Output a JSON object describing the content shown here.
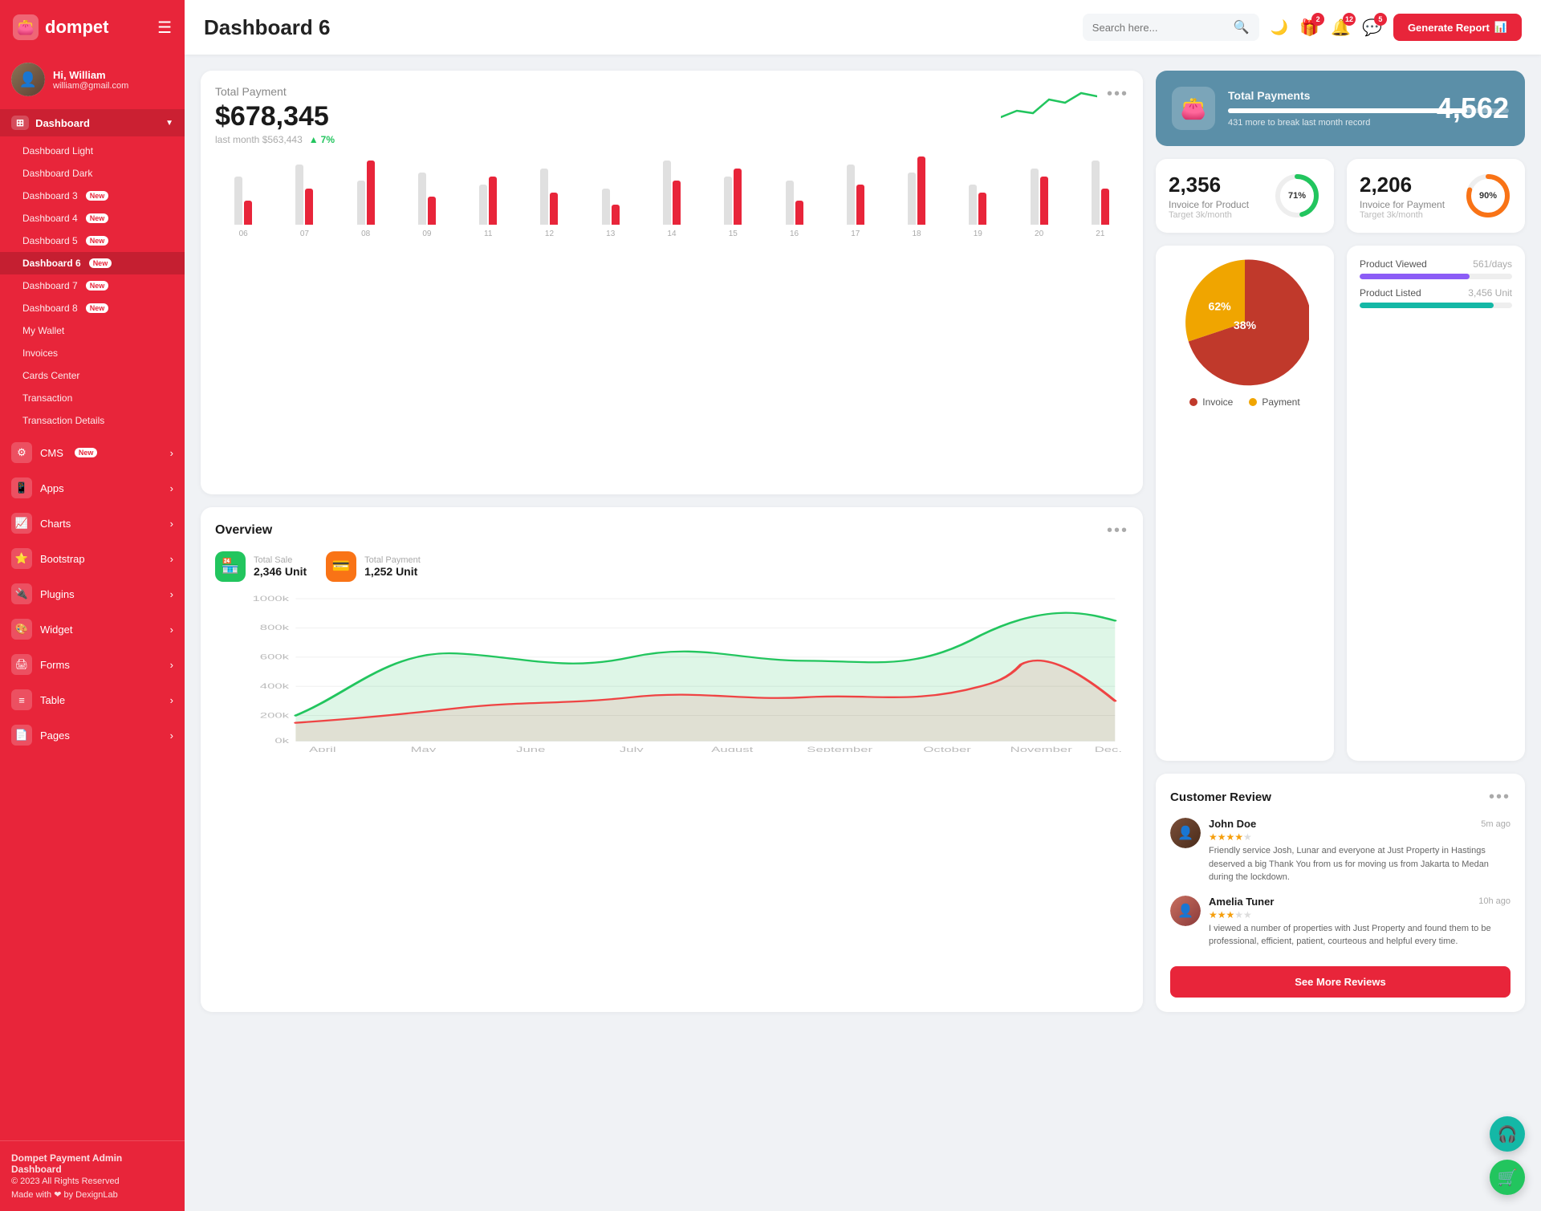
{
  "brand": {
    "name": "dompet",
    "logo_icon": "👛"
  },
  "user": {
    "greeting": "Hi, William",
    "email": "william@gmail.com",
    "avatar_char": "👤"
  },
  "sidebar": {
    "dashboard_label": "Dashboard",
    "items": [
      {
        "label": "Dashboard Light",
        "new": false,
        "active": false
      },
      {
        "label": "Dashboard Dark",
        "new": false,
        "active": false
      },
      {
        "label": "Dashboard 3",
        "new": true,
        "active": false
      },
      {
        "label": "Dashboard 4",
        "new": true,
        "active": false
      },
      {
        "label": "Dashboard 5",
        "new": true,
        "active": false
      },
      {
        "label": "Dashboard 6",
        "new": true,
        "active": true
      },
      {
        "label": "Dashboard 7",
        "new": true,
        "active": false
      },
      {
        "label": "Dashboard 8",
        "new": true,
        "active": false
      },
      {
        "label": "My Wallet",
        "new": false,
        "active": false
      },
      {
        "label": "Invoices",
        "new": false,
        "active": false
      },
      {
        "label": "Cards Center",
        "new": false,
        "active": false
      },
      {
        "label": "Transaction",
        "new": false,
        "active": false
      },
      {
        "label": "Transaction Details",
        "new": false,
        "active": false
      }
    ],
    "menu_items": [
      {
        "label": "CMS",
        "icon": "⚙",
        "new": true,
        "has_arrow": true
      },
      {
        "label": "Apps",
        "icon": "📱",
        "new": false,
        "has_arrow": true
      },
      {
        "label": "Charts",
        "icon": "📈",
        "new": false,
        "has_arrow": true
      },
      {
        "label": "Bootstrap",
        "icon": "⭐",
        "new": false,
        "has_arrow": true
      },
      {
        "label": "Plugins",
        "icon": "🔌",
        "new": false,
        "has_arrow": true
      },
      {
        "label": "Widget",
        "icon": "🎨",
        "new": false,
        "has_arrow": true
      },
      {
        "label": "Forms",
        "icon": "🖨",
        "new": false,
        "has_arrow": true
      },
      {
        "label": "Table",
        "icon": "≡",
        "new": false,
        "has_arrow": true
      },
      {
        "label": "Pages",
        "icon": "📄",
        "new": false,
        "has_arrow": true
      }
    ],
    "footer": {
      "brand": "Dompet Payment Admin Dashboard",
      "copy": "© 2023 All Rights Reserved",
      "made": "Made with ❤ by DexignLab"
    }
  },
  "topbar": {
    "title": "Dashboard 6",
    "search_placeholder": "Search here...",
    "badges": {
      "gift": 2,
      "bell": 12,
      "message": 5
    },
    "generate_btn": "Generate Report"
  },
  "total_payment": {
    "title": "Total Payment",
    "amount": "$678,345",
    "last_month_label": "last month $563,443",
    "trend_pct": "7%",
    "dots": "...",
    "bars": [
      {
        "label": "06",
        "gray": 60,
        "red": 30
      },
      {
        "label": "07",
        "gray": 75,
        "red": 45
      },
      {
        "label": "08",
        "gray": 55,
        "red": 80
      },
      {
        "label": "09",
        "gray": 65,
        "red": 35
      },
      {
        "label": "11",
        "gray": 50,
        "red": 60
      },
      {
        "label": "12",
        "gray": 70,
        "red": 40
      },
      {
        "label": "13",
        "gray": 45,
        "red": 25
      },
      {
        "label": "14",
        "gray": 80,
        "red": 55
      },
      {
        "label": "15",
        "gray": 60,
        "red": 70
      },
      {
        "label": "16",
        "gray": 55,
        "red": 30
      },
      {
        "label": "17",
        "gray": 75,
        "red": 50
      },
      {
        "label": "18",
        "gray": 65,
        "red": 85
      },
      {
        "label": "19",
        "gray": 50,
        "red": 40
      },
      {
        "label": "20",
        "gray": 70,
        "red": 60
      },
      {
        "label": "21",
        "gray": 80,
        "red": 45
      }
    ]
  },
  "total_payments_blue": {
    "title": "Total Payments",
    "subtitle": "431 more to break last month record",
    "value": "4,562",
    "progress_pct": 85,
    "icon": "👛"
  },
  "invoice_product": {
    "number": "2,356",
    "label": "Invoice for Product",
    "target": "Target 3k/month",
    "pct": 71,
    "color": "#22c55e"
  },
  "invoice_payment": {
    "number": "2,206",
    "label": "Invoice for Payment",
    "target": "Target 3k/month",
    "pct": 90,
    "color": "#f97316"
  },
  "overview": {
    "title": "Overview",
    "dots": "...",
    "total_sale": {
      "label": "Total Sale",
      "value": "2,346 Unit"
    },
    "total_payment": {
      "label": "Total Payment",
      "value": "1,252 Unit"
    },
    "y_labels": [
      "1000k",
      "800k",
      "600k",
      "400k",
      "200k",
      "0k"
    ],
    "x_labels": [
      "April",
      "May",
      "June",
      "July",
      "August",
      "September",
      "October",
      "November",
      "Dec."
    ]
  },
  "pie_chart": {
    "invoice_pct": 62,
    "payment_pct": 38,
    "invoice_color": "#c0392b",
    "payment_color": "#f0a500",
    "legend_invoice": "Invoice",
    "legend_payment": "Payment"
  },
  "product_stats": {
    "viewed": {
      "label": "Product Viewed",
      "value": "561/days",
      "pct": 72,
      "color": "purple"
    },
    "listed": {
      "label": "Product Listed",
      "value": "3,456 Unit",
      "pct": 88,
      "color": "teal"
    }
  },
  "customer_review": {
    "title": "Customer Review",
    "dots": "...",
    "reviews": [
      {
        "name": "John Doe",
        "time": "5m ago",
        "stars": 4,
        "text": "Friendly service Josh, Lunar and everyone at Just Property in Hastings deserved a big Thank You from us for moving us from Jakarta to Medan during the lockdown."
      },
      {
        "name": "Amelia Tuner",
        "time": "10h ago",
        "stars": 3,
        "text": "I viewed a number of properties with Just Property and found them to be professional, efficient, patient, courteous and helpful every time."
      }
    ],
    "btn_label": "See More Reviews"
  }
}
